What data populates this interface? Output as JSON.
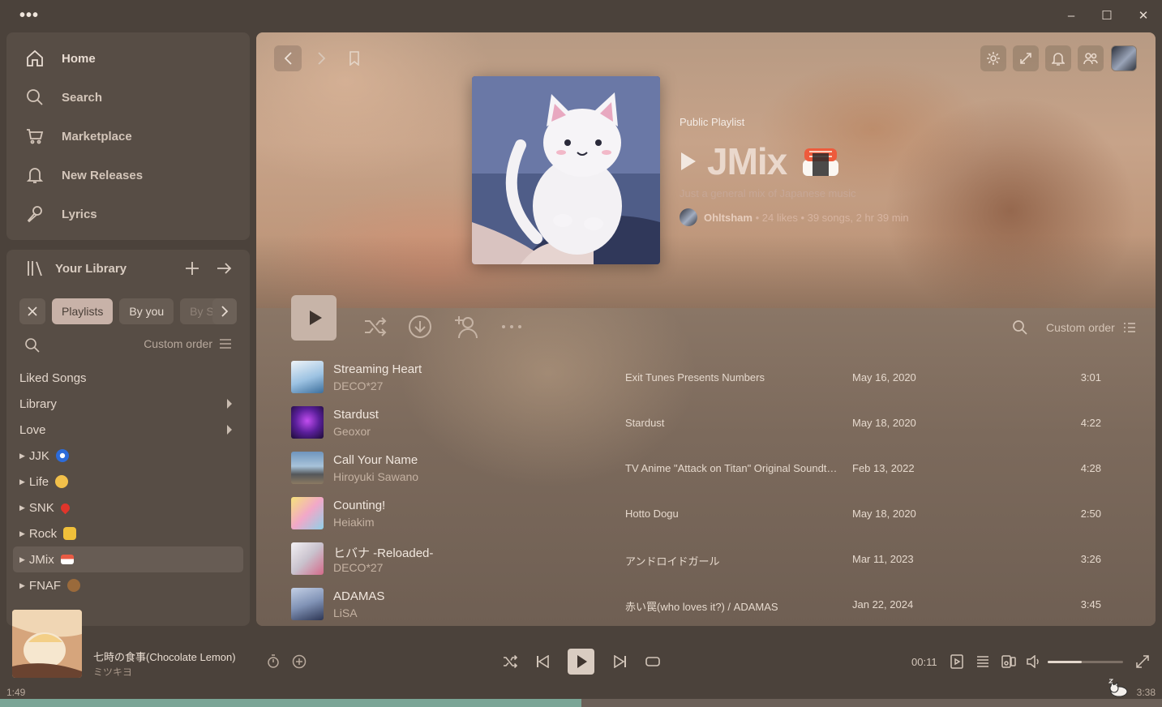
{
  "window": {
    "menu_dots": "•••",
    "minimize": "–",
    "maximize": "☐",
    "close": "✕"
  },
  "nav": {
    "items": [
      {
        "label": "Home",
        "icon": "home-icon"
      },
      {
        "label": "Search",
        "icon": "search-icon"
      },
      {
        "label": "Marketplace",
        "icon": "cart-icon"
      },
      {
        "label": "New Releases",
        "icon": "bell-icon"
      },
      {
        "label": "Lyrics",
        "icon": "microphone-icon"
      }
    ]
  },
  "library": {
    "title": "Your Library",
    "chips": {
      "playlists": "Playlists",
      "by_you": "By you",
      "by_spotify": "By S"
    },
    "sort_label": "Custom order",
    "items": [
      {
        "label": "Liked Songs"
      },
      {
        "label": "Library"
      },
      {
        "label": "Love"
      },
      {
        "label": "JJK",
        "emoji_color": "#2c6bd9"
      },
      {
        "label": "Life",
        "emoji_color": "#f2c04a"
      },
      {
        "label": "SNK",
        "emoji_color": "#e0352b"
      },
      {
        "label": "Rock",
        "emoji_color": "#f0c03a"
      },
      {
        "label": "JMix",
        "emoji_color": "#e85b44"
      },
      {
        "label": "FNAF",
        "emoji_color": "#9a6a3b"
      }
    ]
  },
  "playlist": {
    "type": "Public Playlist",
    "title": "JMix",
    "description": "Just a general mix of Japanese music",
    "owner": "Ohltsham",
    "likes": "24 likes",
    "songs": "39 songs",
    "duration": "2 hr 39 min",
    "sort_label": "Custom order"
  },
  "tracks": [
    {
      "title": "Streaming Heart",
      "artist": "DECO*27",
      "album": "Exit Tunes Presents Numbers",
      "date": "May 16, 2020",
      "duration": "3:01",
      "art_color": "#8fb7d8"
    },
    {
      "title": "Stardust",
      "artist": "Geoxor",
      "album": "Stardust",
      "date": "May 18, 2020",
      "duration": "4:22",
      "art_color": "#5a2a8f"
    },
    {
      "title": "Call Your Name",
      "artist": "Hiroyuki Sawano",
      "album": "TV Anime \"Attack on Titan\" Original Soundtrack",
      "date": "Feb 13, 2022",
      "duration": "4:28",
      "art_color": "#6a8aa8"
    },
    {
      "title": "Counting!",
      "artist": "Heiakim",
      "album": "Hotto Dogu",
      "date": "May 18, 2020",
      "duration": "2:50",
      "art_color": "#e8b8d0"
    },
    {
      "title": "ヒバナ -Reloaded-",
      "artist": "DECO*27",
      "album": "アンドロイドガール",
      "date": "Mar 11, 2023",
      "duration": "3:26",
      "art_color": "#d8d0d8"
    },
    {
      "title": "ADAMAS",
      "artist": "LiSA",
      "album": "赤い罠(who loves it?) / ADAMAS",
      "date": "Jan 22, 2024",
      "duration": "3:45",
      "art_color": "#8ea0c0"
    }
  ],
  "player": {
    "title": "七時の食事(Chocolate Lemon)",
    "artist": "ミツキヨ",
    "position_display": "00:11",
    "elapsed": "1:49",
    "total": "3:38",
    "volume": 0.45,
    "progress": 0.5
  }
}
